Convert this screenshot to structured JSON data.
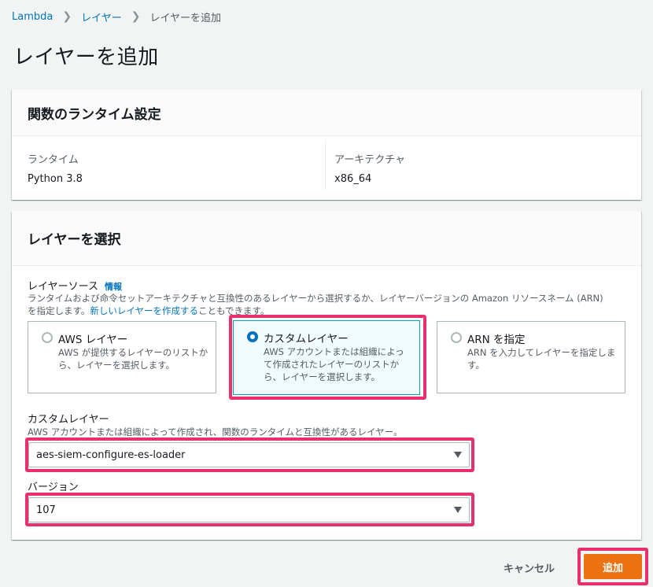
{
  "breadcrumb": {
    "items": [
      "Lambda",
      "レイヤー"
    ],
    "current": "レイヤーを追加"
  },
  "page": {
    "title": "レイヤーを追加"
  },
  "runtime_settings": {
    "title": "関数のランタイム設定",
    "runtime_label": "ランタイム",
    "runtime_value": "Python 3.8",
    "arch_label": "アーキテクチャ",
    "arch_value": "x86_64"
  },
  "layer_select": {
    "title": "レイヤーを選択",
    "source_label": "レイヤーソース",
    "info_link": "情報",
    "source_desc_line1": "ランタイムおよび命令セットアーキテクチャと互換性のあるレイヤーから選択するか、レイヤーバージョンの Amazon リソースネーム (ARN)",
    "source_desc_pre": "を指定します。",
    "source_desc_link": "新しいレイヤーを作成する",
    "source_desc_post": "こともできます。",
    "options": [
      {
        "title": "AWS レイヤー",
        "desc": "AWS が提供するレイヤーのリストから、レイヤーを選択します。",
        "selected": false
      },
      {
        "title": "カスタムレイヤー",
        "desc": "AWS アカウントまたは組織によって作成されたレイヤーのリストから、レイヤーを選択します。",
        "selected": true
      },
      {
        "title": "ARN を指定",
        "desc": "ARN を入力してレイヤーを指定します。",
        "selected": false
      }
    ],
    "custom_layer_label": "カスタムレイヤー",
    "custom_layer_desc": "AWS アカウントまたは組織によって作成され、関数のランタイムと互換性があるレイヤー。",
    "custom_layer_value": "aes-siem-configure-es-loader",
    "version_label": "バージョン",
    "version_value": "107"
  },
  "actions": {
    "cancel": "キャンセル",
    "add": "追加"
  },
  "colors": {
    "highlight": "#e8306f",
    "primary": "#ec7211",
    "link": "#0073bb"
  }
}
